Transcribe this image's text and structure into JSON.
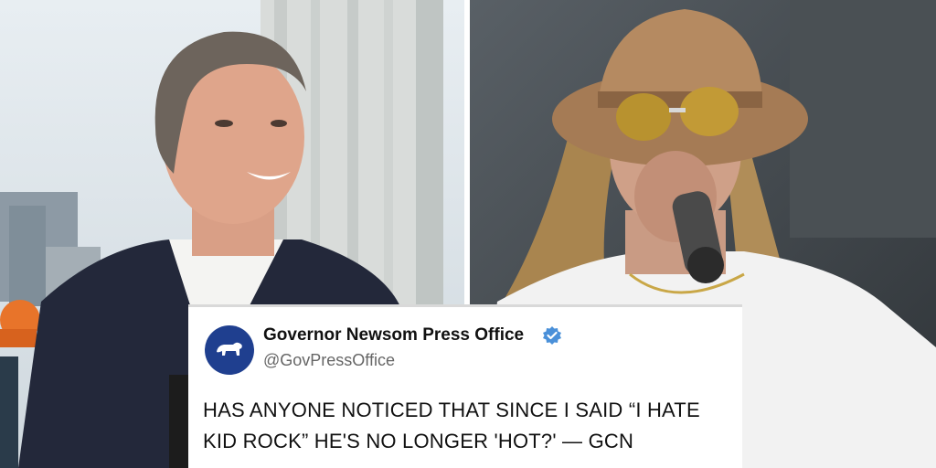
{
  "photos": {
    "left": {
      "subject": "man-in-suit-smiling"
    },
    "right": {
      "subject": "performer-with-hat-and-microphone"
    }
  },
  "tweet": {
    "display_name": "Governor Newsom Press Office",
    "handle": "@GovPressOffice",
    "text": "HAS ANYONE NOTICED THAT SINCE I SAID “I HATE KID ROCK” HE'S NO LONGER 'HOT?' — GCN",
    "verified": true,
    "avatar_icon": "california-bear-icon",
    "avatar_color": "#1f3f8f",
    "verified_color": "#4a90d9"
  }
}
